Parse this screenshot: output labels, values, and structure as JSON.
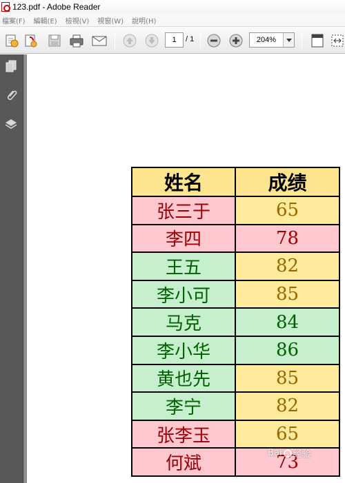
{
  "window": {
    "title": "123.pdf - Adobe Reader"
  },
  "menu": [
    {
      "label": "檔案(F)"
    },
    {
      "label": "編輯(E)"
    },
    {
      "label": "檢視(V)"
    },
    {
      "label": "視窗(W)"
    },
    {
      "label": "說明(H)"
    }
  ],
  "toolbar": {
    "page_current": "1",
    "page_total": "/ 1",
    "zoom": "204%"
  },
  "table": {
    "headers": {
      "name": "姓名",
      "score": "成绩"
    },
    "rows": [
      {
        "name": "张三于",
        "score": "65"
      },
      {
        "name": "李四",
        "score": "78"
      },
      {
        "name": "王五",
        "score": "82"
      },
      {
        "name": "李小可",
        "score": "85"
      },
      {
        "name": "马克",
        "score": "84"
      },
      {
        "name": "李小华",
        "score": "86"
      },
      {
        "name": "黄也先",
        "score": "85"
      },
      {
        "name": "李宁",
        "score": "82"
      },
      {
        "name": "张李玉",
        "score": "65"
      },
      {
        "name": "何斌",
        "score": "73"
      }
    ]
  },
  "colors": {
    "header_bg": "#fde48f",
    "pink_bg": "#ffc7ce",
    "pink_text": "#9c0006",
    "green_bg": "#c6efce",
    "green_text": "#006100",
    "yellow_bg": "#ffeb9c",
    "yellow_text": "#9c6500"
  },
  "watermark": {
    "text": "Bai",
    "text2": "经验"
  }
}
